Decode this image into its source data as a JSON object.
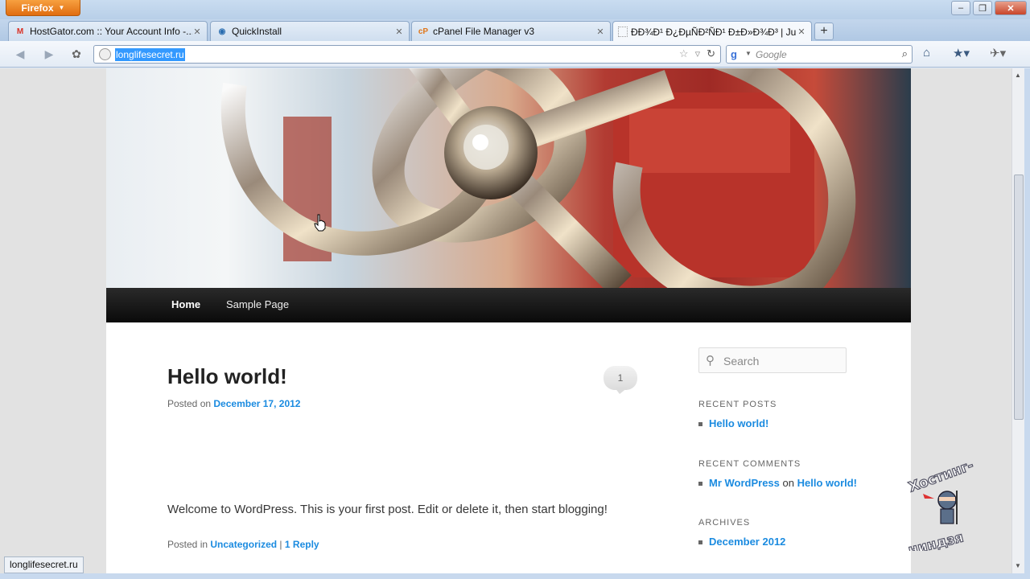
{
  "browser": {
    "app_button": "Firefox",
    "tabs": [
      {
        "label": "HostGator.com :: Your Account Info -...",
        "favicon": "gmail-icon"
      },
      {
        "label": "QuickInstall",
        "favicon": "quickinstall-icon"
      },
      {
        "label": "cPanel File Manager v3",
        "favicon": "cpanel-icon"
      },
      {
        "label": "ÐÐ¾Ð¹ Ð¿ÐµÑÐ²ÑÐ¹ Ð±Ð»Ð¾Ð³ | Ju...",
        "favicon": "blank-page-icon"
      }
    ],
    "new_tab": "+",
    "url": "longlifesecret.ru",
    "search_engine": "Google",
    "status_text": "longlifesecret.ru"
  },
  "site": {
    "menu": [
      "Home",
      "Sample Page"
    ],
    "post": {
      "title": "Hello world!",
      "comment_count": "1",
      "posted_on_label": "Posted on",
      "date": "December 17, 2012",
      "body": "Welcome to WordPress. This is your first post. Edit or delete it, then start blogging!",
      "posted_in_label": "Posted in",
      "category": "Uncategorized",
      "separator": "|",
      "reply_count": "1",
      "reply_label": "Reply"
    },
    "sidebar": {
      "search_placeholder": "Search",
      "recent_posts_title": "RECENT POSTS",
      "recent_posts": [
        "Hello world!"
      ],
      "recent_comments_title": "RECENT COMMENTS",
      "recent_comment": {
        "author": "Mr WordPress",
        "on": "on",
        "post": "Hello world!"
      },
      "archives_title": "ARCHIVES",
      "archives": [
        "December 2012"
      ]
    }
  },
  "watermark": {
    "text": "Хостинг-ниндзя"
  },
  "colors": {
    "link": "#1b8be0",
    "menu_bg": "#111111",
    "firefox_orange": "#e87a1c"
  }
}
